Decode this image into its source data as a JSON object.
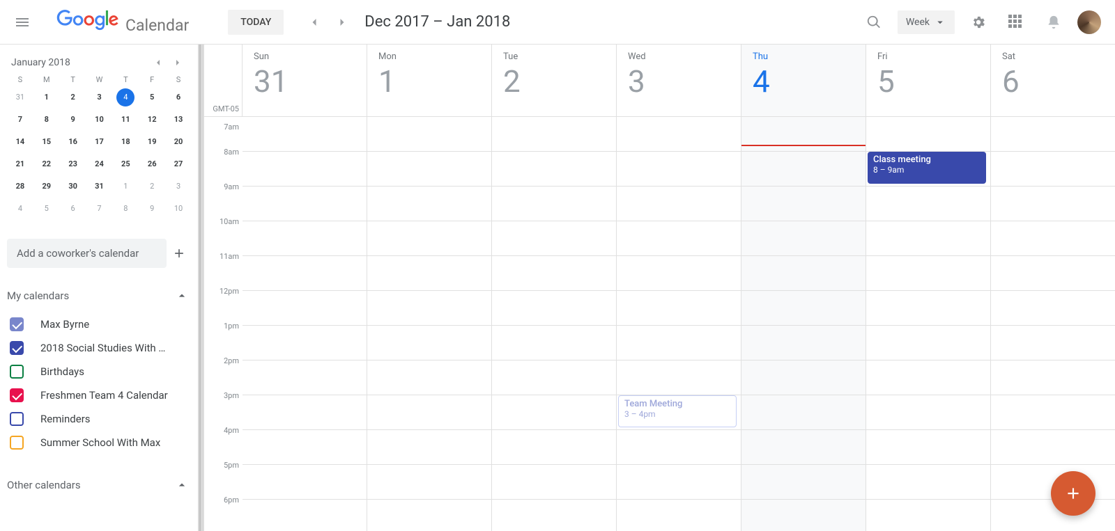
{
  "header": {
    "app_name": "Calendar",
    "today_label": "TODAY",
    "range_label": "Dec 2017 – Jan 2018",
    "view_label": "Week"
  },
  "mini_calendar": {
    "title": "January 2018",
    "dow": [
      "S",
      "M",
      "T",
      "W",
      "T",
      "F",
      "S"
    ],
    "weeks": [
      [
        {
          "n": "31",
          "dim": true
        },
        {
          "n": "1",
          "bold": true
        },
        {
          "n": "2",
          "bold": true
        },
        {
          "n": "3",
          "bold": true
        },
        {
          "n": "4",
          "today": true
        },
        {
          "n": "5",
          "bold": true
        },
        {
          "n": "6",
          "bold": true
        }
      ],
      [
        {
          "n": "7",
          "bold": true
        },
        {
          "n": "8",
          "bold": true
        },
        {
          "n": "9",
          "bold": true
        },
        {
          "n": "10",
          "bold": true
        },
        {
          "n": "11",
          "bold": true
        },
        {
          "n": "12",
          "bold": true
        },
        {
          "n": "13",
          "bold": true
        }
      ],
      [
        {
          "n": "14",
          "bold": true
        },
        {
          "n": "15",
          "bold": true
        },
        {
          "n": "16",
          "bold": true
        },
        {
          "n": "17",
          "bold": true
        },
        {
          "n": "18",
          "bold": true
        },
        {
          "n": "19",
          "bold": true
        },
        {
          "n": "20",
          "bold": true
        }
      ],
      [
        {
          "n": "21",
          "bold": true
        },
        {
          "n": "22",
          "bold": true
        },
        {
          "n": "23",
          "bold": true
        },
        {
          "n": "24",
          "bold": true
        },
        {
          "n": "25",
          "bold": true
        },
        {
          "n": "26",
          "bold": true
        },
        {
          "n": "27",
          "bold": true
        }
      ],
      [
        {
          "n": "28",
          "bold": true
        },
        {
          "n": "29",
          "bold": true
        },
        {
          "n": "30",
          "bold": true
        },
        {
          "n": "31",
          "bold": true
        },
        {
          "n": "1",
          "dim": true
        },
        {
          "n": "2",
          "dim": true
        },
        {
          "n": "3",
          "dim": true
        }
      ],
      [
        {
          "n": "4",
          "dim": true
        },
        {
          "n": "5",
          "dim": true
        },
        {
          "n": "6",
          "dim": true
        },
        {
          "n": "7",
          "dim": true
        },
        {
          "n": "8",
          "dim": true
        },
        {
          "n": "9",
          "dim": true
        },
        {
          "n": "10",
          "dim": true
        }
      ]
    ]
  },
  "add_coworker_placeholder": "Add a coworker's calendar",
  "sections": {
    "my_calendars_label": "My calendars",
    "other_calendars_label": "Other calendars"
  },
  "my_calendars": [
    {
      "name": "Max Byrne",
      "color": "#7986cb",
      "checked": true
    },
    {
      "name": "2018 Social Studies With …",
      "color": "#3949ab",
      "checked": true
    },
    {
      "name": "Birthdays",
      "color": "#0b8043",
      "checked": false
    },
    {
      "name": "Freshmen Team 4 Calendar",
      "color": "#e8114d",
      "checked": true
    },
    {
      "name": "Reminders",
      "color": "#3949ab",
      "checked": false
    },
    {
      "name": "Summer School With Max",
      "color": "#f5a623",
      "checked": false
    }
  ],
  "week": {
    "tz": "GMT-05",
    "days": [
      {
        "dow": "Sun",
        "num": "31"
      },
      {
        "dow": "Mon",
        "num": "1"
      },
      {
        "dow": "Tue",
        "num": "2"
      },
      {
        "dow": "Wed",
        "num": "3"
      },
      {
        "dow": "Thu",
        "num": "4",
        "today": true
      },
      {
        "dow": "Fri",
        "num": "5"
      },
      {
        "dow": "Sat",
        "num": "6"
      }
    ],
    "hours": [
      "7am",
      "8am",
      "9am",
      "10am",
      "11am",
      "12pm",
      "1pm",
      "2pm",
      "3pm",
      "4pm",
      "5pm",
      "6pm"
    ],
    "now_hour_index": 0,
    "now_fraction": 0.8,
    "events": [
      {
        "day": 5,
        "start": 1,
        "span": 1,
        "title": "Class meeting",
        "time": "8 – 9am",
        "style": "solid"
      },
      {
        "day": 3,
        "start": 8,
        "span": 1,
        "title": "Team Meeting",
        "time": "3 – 4pm",
        "style": "outline"
      }
    ]
  }
}
